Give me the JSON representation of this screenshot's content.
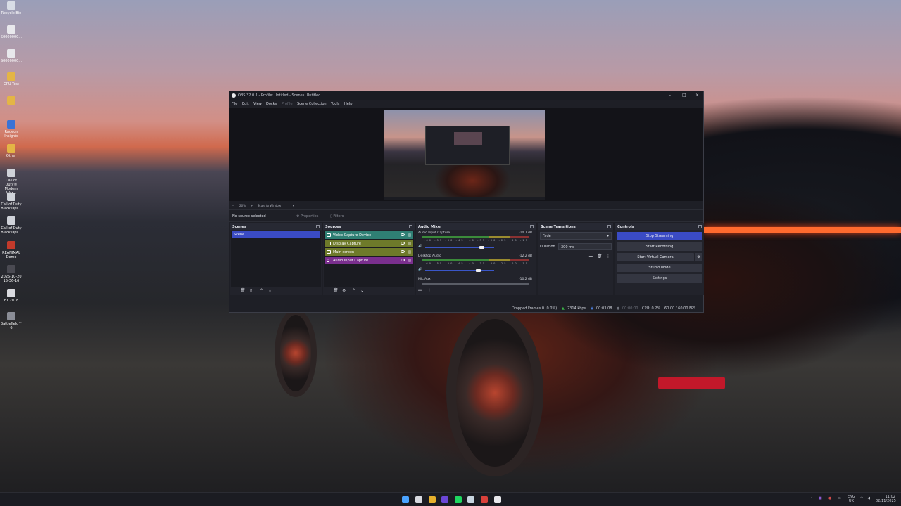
{
  "desktop": {
    "icons": [
      {
        "label": "Recycle Bin",
        "color": "#d8dde6"
      },
      {
        "label": "S0000000...",
        "color": "#e8e8ec"
      },
      {
        "label": "S0000000...",
        "color": "#e8e8ec"
      },
      {
        "label": "GPU Test",
        "color": "#e4b545"
      },
      {
        "label": "",
        "color": "#e4b545"
      },
      {
        "label": "Radeon Insights",
        "color": "#3a73d6"
      },
      {
        "label": "Other",
        "color": "#e4b545"
      },
      {
        "label": "Call of Duty® Modern War...",
        "color": "#cfd2d9"
      },
      {
        "label": "Call of Duty Black Ops...",
        "color": "#cfd2d9"
      },
      {
        "label": "Call of Duty Black Ops...",
        "color": "#cfd2d9"
      },
      {
        "label": "REANIMAL Demo",
        "color": "#c23a2b"
      },
      {
        "label": "2025-10-20 15-36-16",
        "color": "#4a4a52"
      },
      {
        "label": "F1 2018",
        "color": "#d9dadf"
      },
      {
        "label": "Battlefield™ 6",
        "color": "#8a8d96"
      }
    ]
  },
  "obs": {
    "title": "OBS 32.0.1 - Profile: Untitled - Scenes: Untitled",
    "window_controls": {
      "minimize": "–",
      "maximize": "□",
      "close": "×"
    },
    "menu": [
      "File",
      "Edit",
      "View",
      "Docks",
      "Profile",
      "Scene Collection",
      "Tools",
      "Help"
    ],
    "zoom": {
      "minus": "–",
      "value": "26%",
      "plus": "+",
      "mode": "Scale to Window",
      "arrow": "▾"
    },
    "no_source": "No source selected",
    "properties": "Properties",
    "filters": "Filters",
    "docks": {
      "scenes": {
        "title": "Scenes",
        "items": [
          "Scene"
        ]
      },
      "sources": {
        "title": "Sources",
        "items": [
          {
            "label": "Video Capture Device",
            "color": "#2f7f74"
          },
          {
            "label": "Display Capture",
            "color": "#6e7a2a"
          },
          {
            "label": "Main screen",
            "color": "#6e7a2a"
          },
          {
            "label": "Audio Input Capture",
            "color": "#7a2f8e"
          }
        ]
      },
      "mixer": {
        "title": "Audio Mixer",
        "ticks": "-60 -55 -50 -45 -40 -35 -30 -25 -20 -15 -10 -5 0",
        "channels": [
          {
            "name": "Audio Input Capture",
            "db": "-10.7 dB",
            "volume": 0.83
          },
          {
            "name": "Desktop Audio",
            "db": "-12.2 dB",
            "volume": 0.78
          },
          {
            "name": "Mic/Aux",
            "db": "-10.2 dB",
            "volume": 0.8
          }
        ]
      },
      "transitions": {
        "title": "Scene Transitions",
        "type": "Fade",
        "duration_label": "Duration",
        "duration_value": "300 ms"
      },
      "controls": {
        "title": "Controls",
        "buttons": [
          "Stop Streaming",
          "Start Recording",
          "Start Virtual Camera",
          "Studio Mode",
          "Settings"
        ]
      }
    },
    "status": {
      "dropped": "Dropped Frames 0 (0.0%)",
      "kbps": "2314 kbps",
      "stream_time": "00:03:08",
      "rec_time": "00:00:00",
      "cpu": "CPU: 0.2%",
      "fps": "60.00 / 60.00 FPS"
    }
  },
  "taskbar": {
    "apps": [
      {
        "name": "start-icon",
        "color": "#4aa3ff"
      },
      {
        "name": "search-icon",
        "color": "#d7d9e0"
      },
      {
        "name": "chrome-icon",
        "color": "#e6b02c"
      },
      {
        "name": "app-icon",
        "color": "#6b46d6"
      },
      {
        "name": "spotify-icon",
        "color": "#1ed760"
      },
      {
        "name": "steam-icon",
        "color": "#c7d5e0"
      },
      {
        "name": "obs-icon",
        "color": "#d9403a"
      },
      {
        "name": "terminal-icon",
        "color": "#e8e8ec"
      }
    ],
    "lang": "ENG",
    "region": "UK",
    "time": "11:02",
    "date": "02/11/2025"
  },
  "colors": {
    "accent": "#3a4bc4",
    "stop_streaming": "#3a4bc4"
  }
}
